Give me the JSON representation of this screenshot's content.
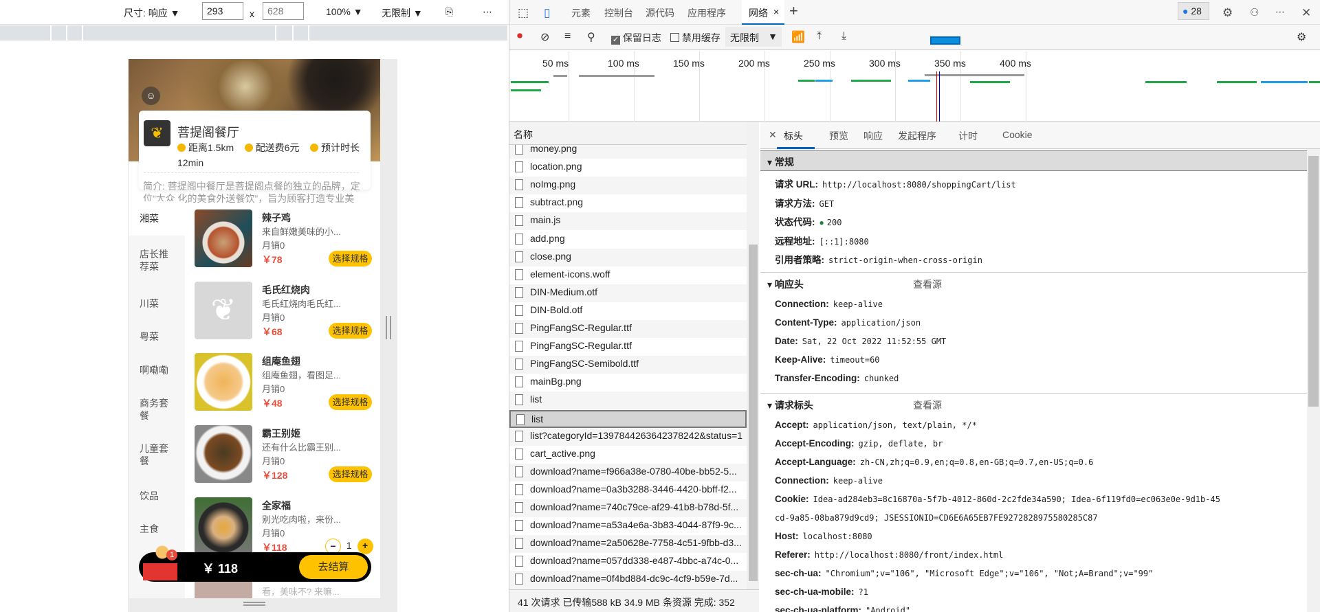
{
  "emulator": {
    "size_label": "尺寸: 响应",
    "width": "293",
    "height": "628",
    "x": "x",
    "zoom": "100%",
    "throttle": "无限制",
    "rotate_icon": "rotate-icon",
    "more": "⋯"
  },
  "app": {
    "shop_name": "菩提阁餐厅",
    "distance": "距离1.5km",
    "delivery_fee": "配送费6元",
    "eta": "预计时长12min",
    "intro": "简介: 菩提阁中餐厅是菩提阁点餐的独立的品牌，定位“大众 化的美食外送餐饮”，旨为顾客打造专业美食",
    "categories": [
      "湘菜",
      "店长推荐菜",
      "川菜",
      "粤菜",
      "啊嘞嘞",
      "商务套餐",
      "儿童套餐",
      "饮品",
      "主食"
    ],
    "dishes": [
      {
        "name": "辣子鸡",
        "desc": "来自鲜嫩美味的小...",
        "sales": "月销0",
        "price": "￥78",
        "button": "选择规格"
      },
      {
        "name": "毛氏红烧肉",
        "desc": "毛氏红烧肉毛氏红...",
        "sales": "月销0",
        "price": "￥68",
        "button": "选择规格"
      },
      {
        "name": "组庵鱼翅",
        "desc": "组庵鱼翅，看图足...",
        "sales": "月销0",
        "price": "￥48",
        "button": "选择规格"
      },
      {
        "name": "霸王别姬",
        "desc": "还有什么比霸王别...",
        "sales": "月销0",
        "price": "￥128",
        "button": "选择规格"
      },
      {
        "name": "全家福",
        "desc": "别光吃肉啦，来份...",
        "sales": "月销0",
        "price": "￥118",
        "qty": "1",
        "minus": "−",
        "plus": "+"
      }
    ],
    "next_desc": "看，美味不? 来嘛...",
    "cart": {
      "badge": "1",
      "total": "￥ 118",
      "checkout": "去结算"
    }
  },
  "devtools": {
    "tabs": [
      "元素",
      "控制台",
      "源代码",
      "应用程序",
      "网络"
    ],
    "active_tab": "网络",
    "close": "×",
    "add": "+",
    "issues_count": "28",
    "toolbar": {
      "preserve_log": "保留日志",
      "preserve_log_checked": true,
      "disable_cache": "禁用缓存",
      "disable_cache_checked": false,
      "throttle": "无限制"
    },
    "timeline_ticks": [
      "50 ms",
      "100 ms",
      "150 ms",
      "200 ms",
      "250 ms",
      "300 ms",
      "350 ms",
      "400 ms"
    ],
    "list_header": "名称",
    "requests": [
      "money.png",
      "location.png",
      "noImg.png",
      "subtract.png",
      "main.js",
      "add.png",
      "close.png",
      "element-icons.woff",
      "DIN-Medium.otf",
      "DIN-Bold.otf",
      "PingFangSC-Regular.ttf",
      "PingFangSC-Regular.ttf",
      "PingFangSC-Semibold.ttf",
      "mainBg.png",
      "list",
      "list",
      "list?categoryId=1397844263642378242&status=1",
      "cart_active.png",
      "download?name=f966a38e-0780-40be-bb52-5...",
      "download?name=0a3b3288-3446-4420-bbff-f2...",
      "download?name=740c79ce-af29-41b8-b78d-5f...",
      "download?name=a53a4e6a-3b83-4044-87f9-9c...",
      "download?name=2a50628e-7758-4c51-9fbb-d3...",
      "download?name=057dd338-e487-4bbc-a74c-0...",
      "download?name=0f4bd884-dc9c-4cf9-b59e-7d..."
    ],
    "selected_index": 15,
    "status": "41 次请求  已传输588 kB  34.9 MB 条资源  完成: 352",
    "detail_tabs": [
      "标头",
      "预览",
      "响应",
      "发起程序",
      "计时",
      "Cookie"
    ],
    "general_title": "常规",
    "general": [
      [
        "请求 URL:",
        "http://localhost:8080/shoppingCart/list"
      ],
      [
        "请求方法:",
        "GET"
      ],
      [
        "状态代码:",
        "200"
      ],
      [
        "远程地址:",
        "[::1]:8080"
      ],
      [
        "引用者策略:",
        "strict-origin-when-cross-origin"
      ]
    ],
    "response_title": "响应头",
    "view_source": "查看源",
    "response_headers": [
      [
        "Connection:",
        "keep-alive"
      ],
      [
        "Content-Type:",
        "application/json"
      ],
      [
        "Date:",
        "Sat, 22 Oct 2022 11:52:55 GMT"
      ],
      [
        "Keep-Alive:",
        "timeout=60"
      ],
      [
        "Transfer-Encoding:",
        "chunked"
      ]
    ],
    "request_title": "请求标头",
    "request_headers": [
      [
        "Accept:",
        "application/json, text/plain, */*"
      ],
      [
        "Accept-Encoding:",
        "gzip, deflate, br"
      ],
      [
        "Accept-Language:",
        "zh-CN,zh;q=0.9,en;q=0.8,en-GB;q=0.7,en-US;q=0.6"
      ],
      [
        "Connection:",
        "keep-alive"
      ],
      [
        "Cookie:",
        "Idea-ad284eb3=8c16870a-5f7b-4012-860d-2c2fde34a590; Idea-6f119fd0=ec063e0e-9d1b-45"
      ],
      [
        "",
        "cd-9a85-08ba879d9cd9; JSESSIONID=CD6E6A65EB7FE9272828975580285C87"
      ],
      [
        "Host:",
        "localhost:8080"
      ],
      [
        "Referer:",
        "http://localhost:8080/front/index.html"
      ],
      [
        "sec-ch-ua:",
        "\"Chromium\";v=\"106\", \"Microsoft Edge\";v=\"106\", \"Not;A=Brand\";v=\"99\""
      ],
      [
        "sec-ch-ua-mobile:",
        "?1"
      ],
      [
        "sec-ch-ua-platform:",
        "\"Android\""
      ]
    ]
  },
  "colors": {
    "accent": "#ffc200",
    "price": "#e94e3c",
    "devtools_blue": "#0067c0"
  }
}
